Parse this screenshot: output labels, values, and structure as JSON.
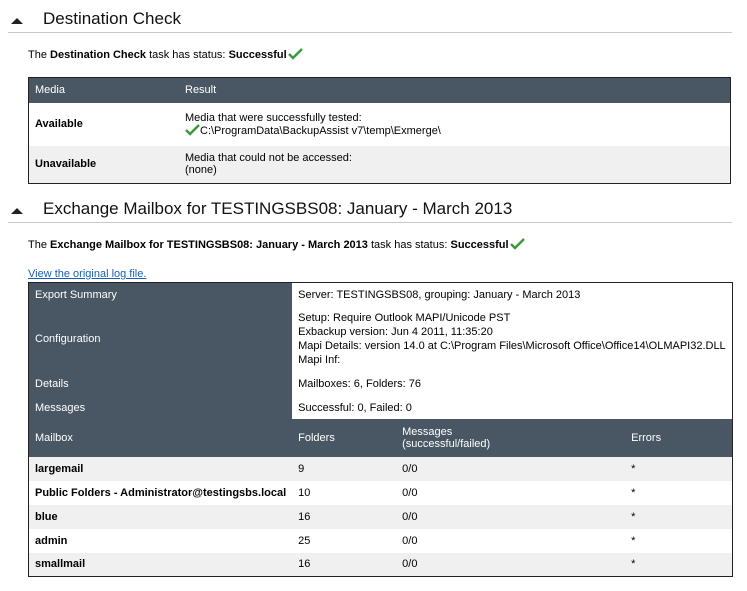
{
  "destination_check": {
    "title": "Destination Check",
    "status_prefix": "The",
    "task_name": "Destination Check",
    "status_mid": "task has status:",
    "status_value": "Successful",
    "headers": {
      "media": "Media",
      "result": "Result"
    },
    "rows": [
      {
        "label": "Available",
        "line1": "Media that were successfully tested:",
        "line2": "C:\\ProgramData\\BackupAssist v7\\temp\\Exmerge\\"
      },
      {
        "label": "Unavailable",
        "line1": "Media that could not be accessed:",
        "line2": "(none)"
      }
    ]
  },
  "exchange": {
    "title": "Exchange Mailbox for TESTINGSBS08: January - March 2013",
    "status_prefix": "The",
    "task_name": "Exchange Mailbox for TESTINGSBS08: January - March 2013",
    "status_mid": "task has status:",
    "status_value": "Successful",
    "log_link": "View the original log file.",
    "summary": {
      "export_summary_label": "Export Summary",
      "export_summary_value": "Server: TESTINGSBS08, grouping: January - March 2013",
      "configuration_label": "Configuration",
      "configuration_lines": [
        "Setup: Require Outlook MAPI/Unicode PST",
        "Exbackup version: Jun 4 2011, 11:35:20",
        "Mapi Details: version 14.0 at C:\\Program Files\\Microsoft Office\\Office14\\OLMAPI32.DLL",
        "Mapi Inf:"
      ],
      "details_label": "Details",
      "details_value": "Mailboxes: 6, Folders: 76",
      "messages_label": "Messages",
      "messages_value": "Successful: 0, Failed: 0"
    },
    "mailbox_headers": {
      "mailbox": "Mailbox",
      "folders": "Folders",
      "messages_line1": "Messages",
      "messages_line2": "(successful/failed)",
      "errors": "Errors"
    },
    "mailboxes": [
      {
        "name": "largemail",
        "folders": "9",
        "messages": "0/0",
        "errors": "*"
      },
      {
        "name": "Public Folders - Administrator@testingsbs.local",
        "folders": "10",
        "messages": "0/0",
        "errors": "*"
      },
      {
        "name": "blue",
        "folders": "16",
        "messages": "0/0",
        "errors": "*"
      },
      {
        "name": "admin",
        "folders": "25",
        "messages": "0/0",
        "errors": "*"
      },
      {
        "name": "smallmail",
        "folders": "16",
        "messages": "0/0",
        "errors": "*"
      }
    ]
  },
  "colors": {
    "header_bg": "#495663",
    "success_check": "#3a9a3a",
    "link": "#1a5fb4",
    "alt_row": "#f0f0f0"
  },
  "icons": [
    "collapse-arrow-icon",
    "checkmark-icon"
  ]
}
